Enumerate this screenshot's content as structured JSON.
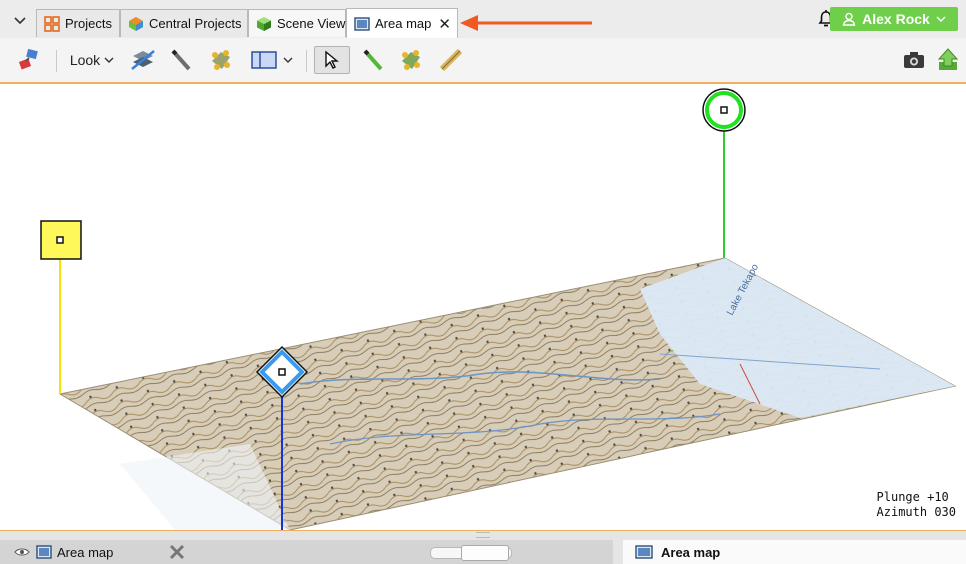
{
  "tabs": [
    {
      "label": "Projects",
      "icon": "projects-grid-icon"
    },
    {
      "label": "Central Projects",
      "icon": "central-projects-icon"
    },
    {
      "label": "Scene View",
      "icon": "scene-cube-icon"
    },
    {
      "label": "Area map",
      "icon": "area-map-icon",
      "close": "✕"
    }
  ],
  "user": {
    "name": "Alex Rock"
  },
  "toolbar": {
    "look_label": "Look"
  },
  "hud": {
    "plunge": "Plunge +10",
    "azimuth": "Azimuth 030"
  },
  "bottom": {
    "layer_label": "Area map",
    "properties_title": "Area map"
  },
  "map_labels": [
    "Lake Tekapo"
  ],
  "colors": {
    "accent": "#f0b060",
    "user_button": "#6fcf4a",
    "annotation_arrow": "#f05a22"
  }
}
